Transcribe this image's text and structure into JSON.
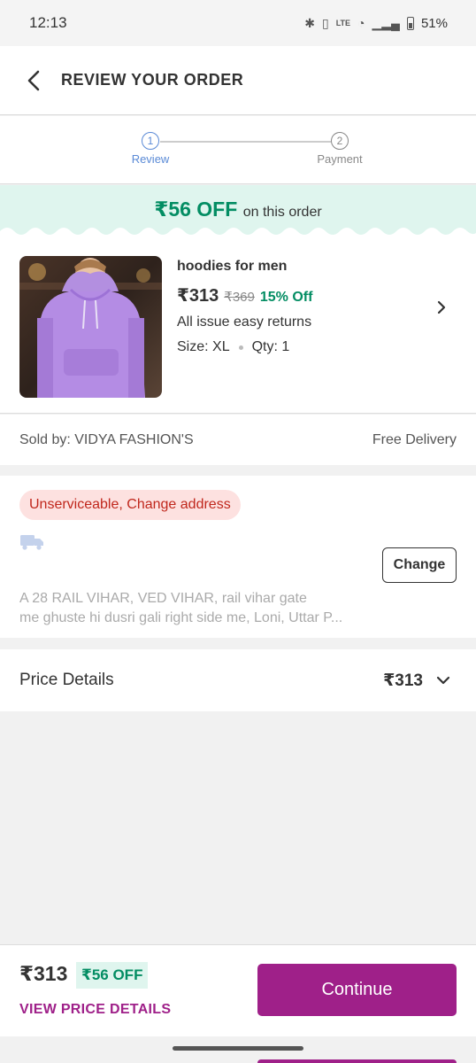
{
  "status_bar": {
    "time": "12:13",
    "battery": "51%",
    "icons": [
      "bluetooth-icon",
      "vibrate-icon",
      "volte-icon",
      "wifi-icon",
      "signal-icon",
      "battery-icon"
    ]
  },
  "header": {
    "title": "REVIEW YOUR ORDER"
  },
  "stepper": {
    "steps": [
      {
        "number": "1",
        "label": "Review",
        "state": "active"
      },
      {
        "number": "2",
        "label": "Payment",
        "state": "inactive"
      }
    ]
  },
  "offer_banner": {
    "amount": "₹56 OFF",
    "text": "on this order"
  },
  "product": {
    "name": "hoodies for men",
    "price": "₹313",
    "mrp": "₹369",
    "discount": "15% Off",
    "returns": "All issue easy returns",
    "size": "Size: XL",
    "qty": "Qty: 1"
  },
  "seller": {
    "label": "Sold by: VIDYA FASHION'S",
    "delivery": "Free Delivery"
  },
  "address": {
    "badge": "Unserviceable, Change address",
    "change_label": "Change",
    "line1": "A 28 RAIL VIHAR, VED VIHAR, rail vihar gate",
    "line2": "me ghuste hi dusri gali right side me, Loni, Uttar P..."
  },
  "price_details": {
    "label": "Price Details",
    "amount": "₹313"
  },
  "bottom_bar": {
    "price": "₹313",
    "off": "₹56 OFF",
    "view_details": "VIEW PRICE DETAILS",
    "continue_label": "Continue"
  },
  "colors": {
    "accent": "#9f2089",
    "success": "#038d63",
    "error": "#c0271c",
    "link": "#5a8ad6"
  }
}
